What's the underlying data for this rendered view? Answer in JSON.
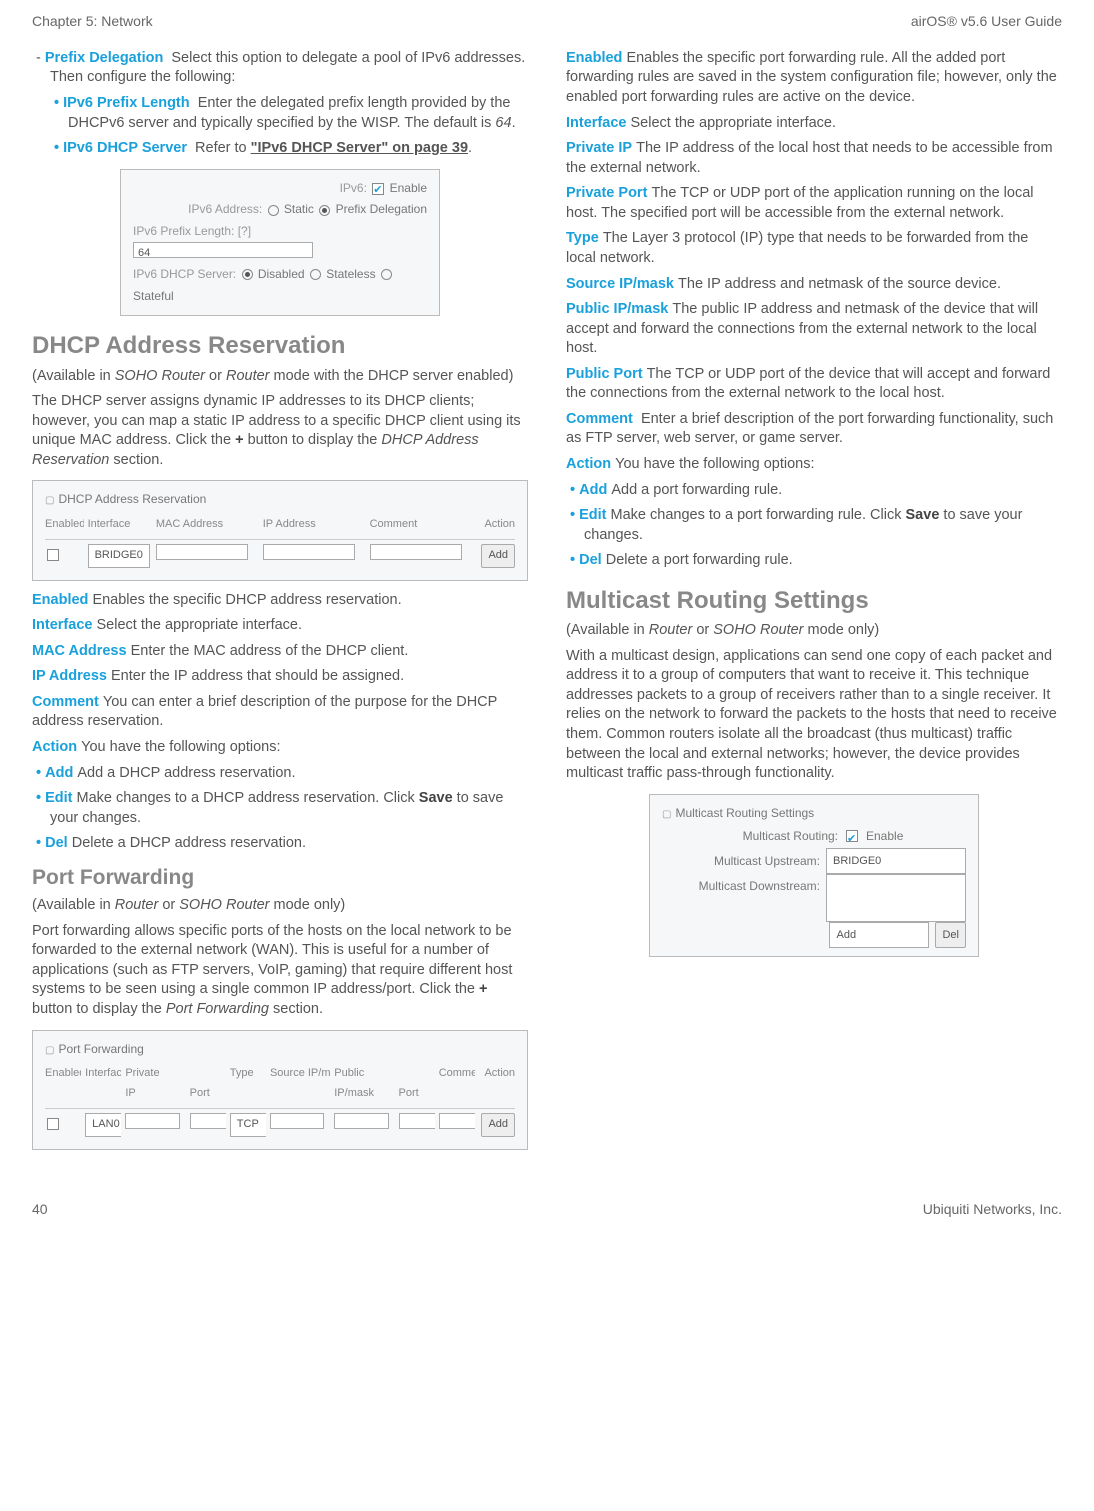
{
  "header": {
    "left": "Chapter 5: Network",
    "right": "airOS® v5.6 User Guide"
  },
  "footer": {
    "left": "40",
    "right": "Ubiquiti Networks, Inc."
  },
  "col1": {
    "pd_term": "Prefix Delegation",
    "pd_body": "Select this option to delegate a pool of IPv6 addresses. Then configure the following:",
    "ipl_term": "IPv6 Prefix Length",
    "ipl_body1": "Enter the delegated prefix length provided by the DHCPv6 server and typically specified by the WISP. The default is ",
    "ipl_body_italic": "64",
    "ipl_body_end": ".",
    "ids_term": "IPv6 DHCP Server",
    "ids_body_pre": "Refer to ",
    "ids_link": "\"IPv6 DHCP Server\" on page 39",
    "ids_body_end": ".",
    "ipv6_panel": {
      "r1_lbl": "IPv6:",
      "r1_enable": "Enable",
      "r2_lbl": "IPv6 Address:",
      "r2_opt1": "Static",
      "r2_opt2": "Prefix Delegation",
      "r3_lbl": "IPv6 Prefix Length: [?]",
      "r3_val": "64",
      "r4_lbl": "IPv6 DHCP Server:",
      "r4_o1": "Disabled",
      "r4_o2": "Stateless",
      "r4_o3": "Stateful"
    },
    "dhcp_h": "DHCP Address Reservation",
    "dhcp_avail_pre": "(Available in ",
    "dhcp_avail_i1": "SOHO Router",
    "dhcp_avail_mid": " or ",
    "dhcp_avail_i2": "Router",
    "dhcp_avail_post": " mode with the DHCP server enabled)",
    "dhcp_p_pre": "The DHCP server assigns dynamic IP addresses to its DHCP clients; however, you can map a static IP address to a specific DHCP client using its unique MAC address. Click the ",
    "dhcp_p_b": "+",
    "dhcp_p_mid": " button to display the ",
    "dhcp_p_i": "DHCP Address Reservation",
    "dhcp_p_end": " section.",
    "dhcp_tbl": {
      "title": "DHCP Address Reservation",
      "h1": "Enabled",
      "h2": "Interface",
      "h3": "MAC Address",
      "h4": "IP Address",
      "h5": "Comment",
      "h6": "Action",
      "if": "BRIDGE0",
      "add": "Add"
    },
    "d_en_t": "Enabled",
    "d_en_b": "Enables the specific DHCP address reservation.",
    "d_if_t": "Interface",
    "d_if_b": "Select the appropriate interface.",
    "d_mac_t": "MAC Address",
    "d_mac_b": "Enter the MAC address of the DHCP client.",
    "d_ip_t": "IP Address",
    "d_ip_b": "Enter the IP address that should be assigned.",
    "d_cm_t": "Comment",
    "d_cm_b": "You can enter a brief description of the purpose for the DHCP address reservation.",
    "d_ac_t": "Action",
    "d_ac_b": "You have the following options:",
    "d_add_t": "Add",
    "d_add_b": "Add a DHCP address reservation.",
    "d_edit_t": "Edit",
    "d_edit_b_pre": "Make changes to a DHCP address reservation. Click ",
    "d_edit_b_b": "Save",
    "d_edit_b_post": " to save your changes.",
    "d_del_t": "Del",
    "d_del_b": "Delete a DHCP address reservation.",
    "pf_h": "Port Forwarding",
    "pf_avail_pre": "(Available in ",
    "pf_avail_i1": "Router",
    "pf_avail_mid": " or ",
    "pf_avail_i2": "SOHO Router",
    "pf_avail_post": " mode only)",
    "pf_p_pre": "Port forwarding allows specific ports of the hosts on the local network to be forwarded to the external network (WAN). This is useful for a number of applications (such as FTP servers, VoIP, gaming) that require different host systems to be seen using a single common IP address/port. Click the ",
    "pf_p_b": "+",
    "pf_p_mid": " button to display the ",
    "pf_p_i": "Port Forwarding",
    "pf_p_end": " section.",
    "pf_tbl": {
      "title": "Port Forwarding",
      "h1": "Enabled",
      "h2": "Interface",
      "h3a": "Private",
      "h3b": "IP",
      "h3c": "Port",
      "h4": "Type",
      "h5": "Source IP/mask",
      "h6a": "Public",
      "h6b": "IP/mask",
      "h6c": "Port",
      "h7": "Comment",
      "h8": "Action",
      "if": "LAN0",
      "type": "TCP",
      "add": "Add"
    }
  },
  "col2": {
    "en_t": "Enabled",
    "en_b": "Enables the specific port forwarding rule. All the added port forwarding rules are saved in the system configuration file; however, only the enabled port forwarding rules are active on the device.",
    "if_t": "Interface",
    "if_b": "Select the appropriate interface.",
    "pip_t": "Private IP",
    "pip_b": "The IP address of the local host that needs to be accessible from the external network.",
    "ppt_t": "Private Port",
    "ppt_b": "The TCP or UDP port of the application running on the local host. The specified port will be accessible from the external network.",
    "ty_t": "Type",
    "ty_b": "The Layer 3 protocol (IP) type that needs to be forwarded from the local network.",
    "sip_t": "Source IP/mask",
    "sip_b": "The IP address and netmask of the source device.",
    "puim_t": "Public IP/mask",
    "puim_b": "The public IP address and netmask of the device that will accept and forward the connections from the external network to the local host.",
    "pupt_t": "Public Port",
    "pupt_b": "The TCP or UDP port of the device that will accept and forward the connections from the external network to the local host.",
    "cm_t": "Comment",
    "cm_b": "Enter a brief description of the port forwarding functionality, such as FTP server, web server, or game server.",
    "ac_t": "Action",
    "ac_b": "You have the following options:",
    "add_t": "Add",
    "add_b": "Add a port forwarding rule.",
    "edit_t": "Edit",
    "edit_b_pre": "Make changes to a port forwarding rule. Click ",
    "edit_b_b": "Save",
    "edit_b_post": " to save your changes.",
    "del_t": "Del",
    "del_b": "Delete a port forwarding rule.",
    "mr_h": "Multicast Routing Settings",
    "mr_avail_pre": "(Available in ",
    "mr_avail_i1": "Router",
    "mr_avail_mid": " or ",
    "mr_avail_i2": "SOHO Router",
    "mr_avail_post": " mode only)",
    "mr_p": "With a multicast design, applications can send one copy of each packet and address it to a group of computers that want to receive it. This technique addresses packets to a group of receivers rather than to a single receiver. It relies on the network to forward the packets to the hosts that need to receive them. Common routers isolate all the broadcast (thus multicast) traffic between the local and external networks; however, the device provides multicast traffic pass-through functionality.",
    "mr_panel": {
      "title": "Multicast Routing Settings",
      "r1_lbl": "Multicast Routing:",
      "r1_en": "Enable",
      "r2_lbl": "Multicast Upstream:",
      "r2_val": "BRIDGE0",
      "r3_lbl": "Multicast Downstream:",
      "add_sel": "Add",
      "del": "Del"
    }
  }
}
